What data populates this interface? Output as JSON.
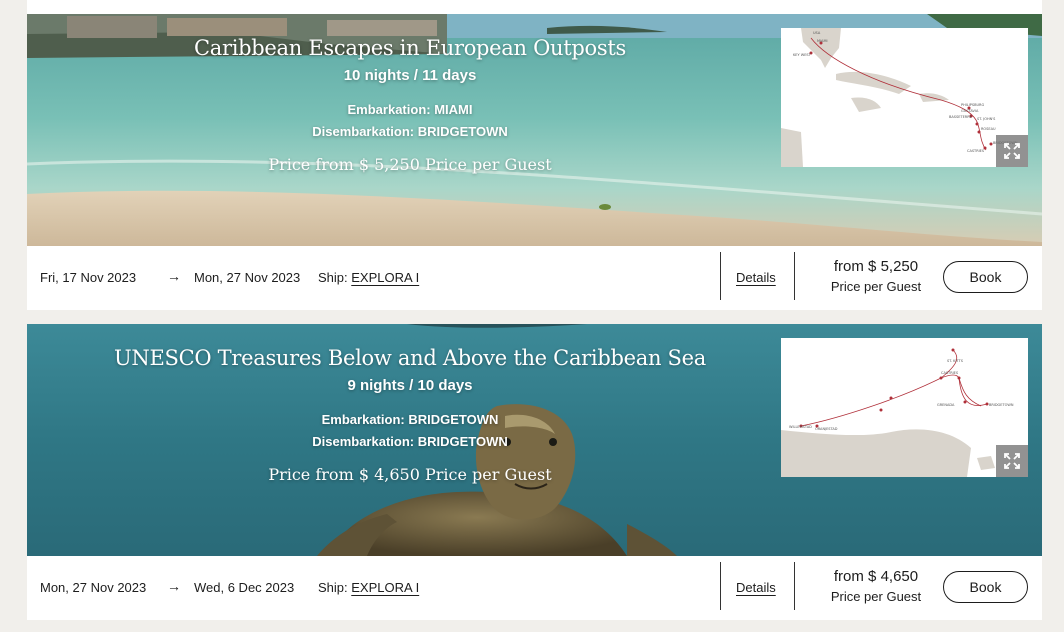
{
  "cruises": [
    {
      "title": "Caribbean Escapes in European Outposts",
      "duration": "10 nights / 11 days",
      "embarkation": "Embarkation: MIAMI",
      "disembarkation": "Disembarkation: BRIDGETOWN",
      "hero_price": "Price from $ 5,250 Price per Guest",
      "date_from": "Fri, 17 Nov 2023",
      "arrow": "→",
      "date_to": "Mon, 27 Nov 2023",
      "ship_label": "Ship:",
      "ship_name": "EXPLORA I",
      "details_label": "Details",
      "price_from": "from $ 5,250",
      "price_per": "Price per Guest",
      "book_label": "Book",
      "map_labels": [
        "USA",
        "MIAMI",
        "KEY WEST",
        "PHILIPSBURG",
        "GUSTAVIA",
        "ST. JOHN'S",
        "BASSETERRE",
        "ROSEAU",
        "CASTRIES",
        "BRIDGETOWN"
      ]
    },
    {
      "title": "UNESCO Treasures Below and Above the Caribbean Sea",
      "duration": "9 nights / 10 days",
      "embarkation": "Embarkation: BRIDGETOWN",
      "disembarkation": "Disembarkation: BRIDGETOWN",
      "hero_price": "Price from $ 4,650 Price per Guest",
      "date_from": "Mon, 27 Nov 2023",
      "arrow": "→",
      "date_to": "Wed, 6 Dec 2023",
      "ship_label": "Ship:",
      "ship_name": "EXPLORA I",
      "details_label": "Details",
      "price_from": "from $ 4,650",
      "price_per": "Price per Guest",
      "book_label": "Book",
      "map_labels": [
        "ST. KITTS",
        "CASTRIES",
        "GRENADA",
        "BRIDGETOWN",
        "WILLEMSTAD",
        "ORANJESTAD"
      ]
    }
  ],
  "icons": {
    "expand": "expand-icon"
  },
  "colors": {
    "background": "#f1efeb",
    "card": "#ffffff",
    "route": "#b0303a",
    "land": "#d9d4cc"
  }
}
